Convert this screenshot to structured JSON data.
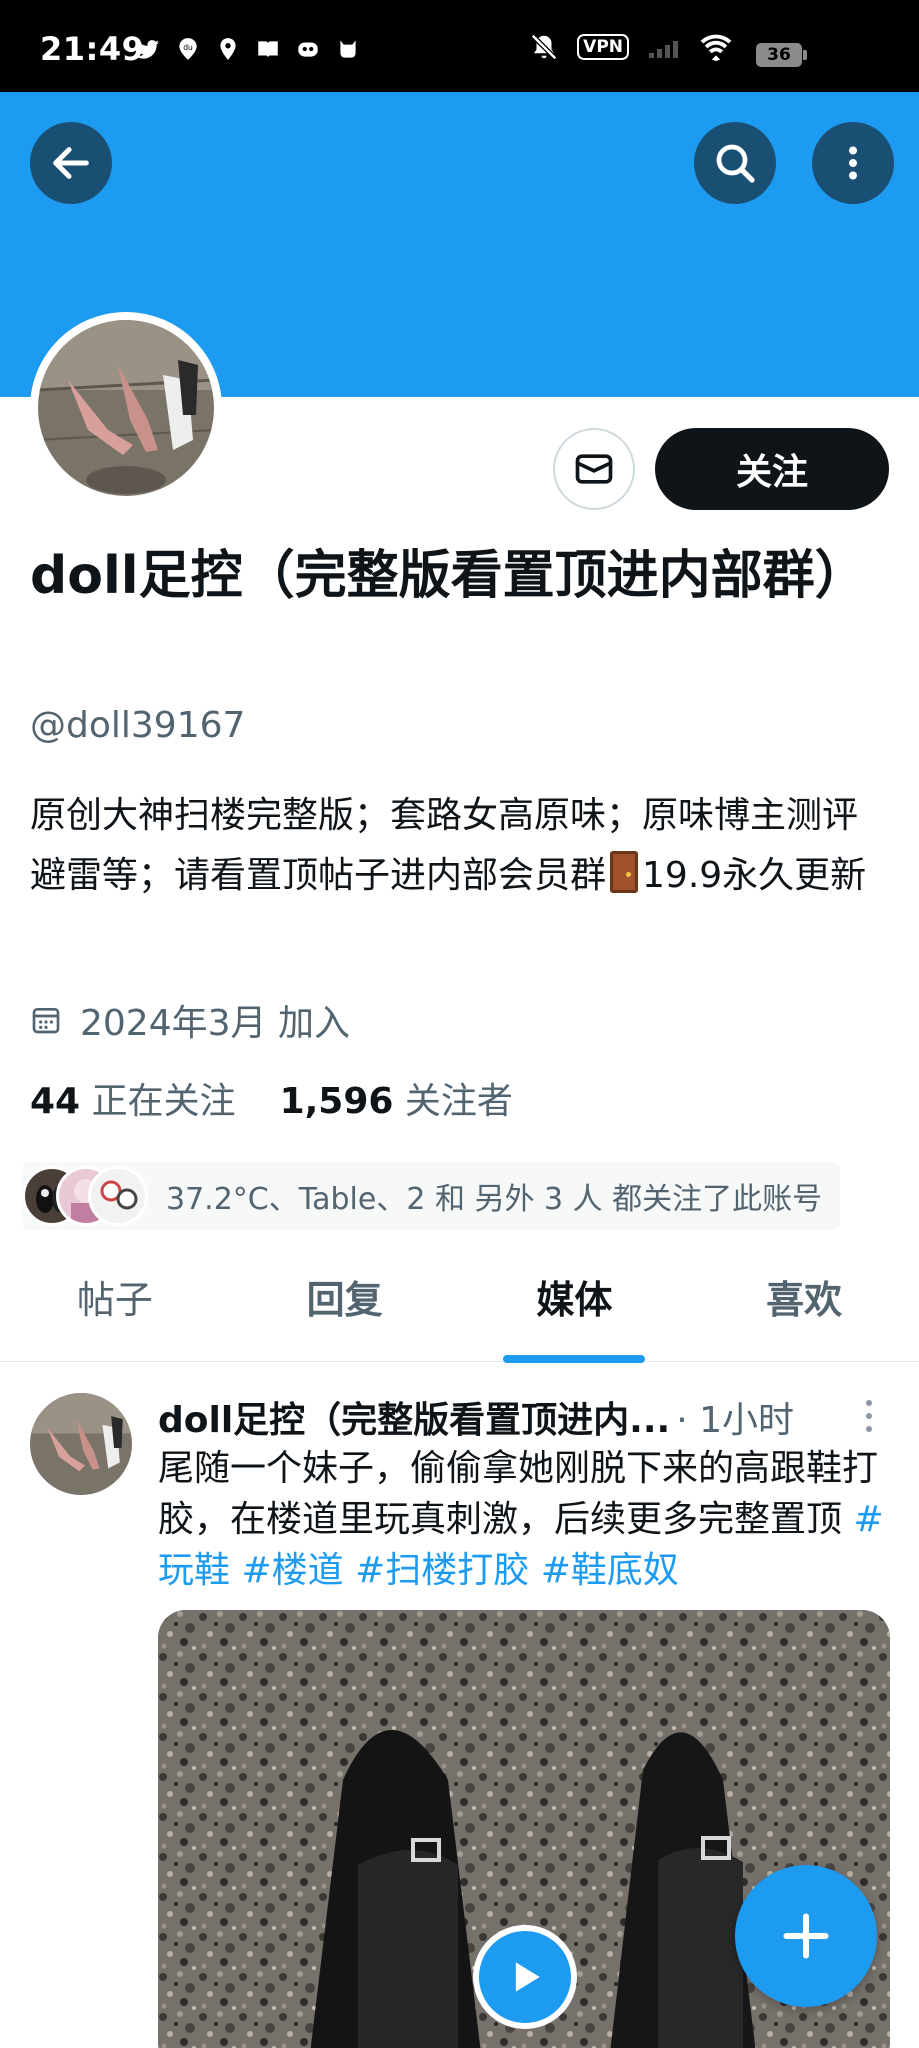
{
  "status_bar": {
    "time": "21:49",
    "left_icons": [
      "twitter-icon",
      "baidu-icon",
      "location-icon",
      "book-icon",
      "bot-icon",
      "cat-icon"
    ],
    "vpn_label": "VPN",
    "battery": "36",
    "right_icons": [
      "mute-icon",
      "signal-icon",
      "wifi-icon"
    ]
  },
  "header": {
    "banner_color": "#1d9bf0",
    "back_icon": "arrow-left-icon",
    "search_icon": "search-icon",
    "more_icon": "more-vertical-icon"
  },
  "profile": {
    "display_name": "doll足控（完整版看置顶进内部群）",
    "handle": "@doll39167",
    "bio_part1": "原创大神扫楼完整版；套路女高原味；原味博主测评避雷等；请看置顶帖子进内部会员群",
    "bio_emoji": "🚪",
    "bio_part2": "19.9永久更新",
    "joined": "2024年3月 加入",
    "following_count": "44",
    "following_label": "正在关注",
    "followers_count": "1,596",
    "followers_label": "关注者",
    "mutuals_text": "37.2°C、Table、2 和 另外 3 人 都关注了此账号",
    "follow_label": "关注",
    "message_icon": "mail-icon"
  },
  "tabs": [
    {
      "label": "帖子",
      "active": false
    },
    {
      "label": "回复",
      "active": false
    },
    {
      "label": "媒体",
      "active": true
    },
    {
      "label": "喜欢",
      "active": false
    }
  ],
  "post": {
    "author": "doll足控（完整版看置顶进内...",
    "time": "· 1小时",
    "text": "尾随一个妹子，偷偷拿她刚脱下来的高跟鞋打胶，在楼道里玩真刺激，后续更多完整置顶 ",
    "hashtags": [
      "#玩鞋",
      "#楼道",
      "#扫楼打胶",
      "#鞋底奴"
    ]
  },
  "accent_color": "#1d9bf0"
}
